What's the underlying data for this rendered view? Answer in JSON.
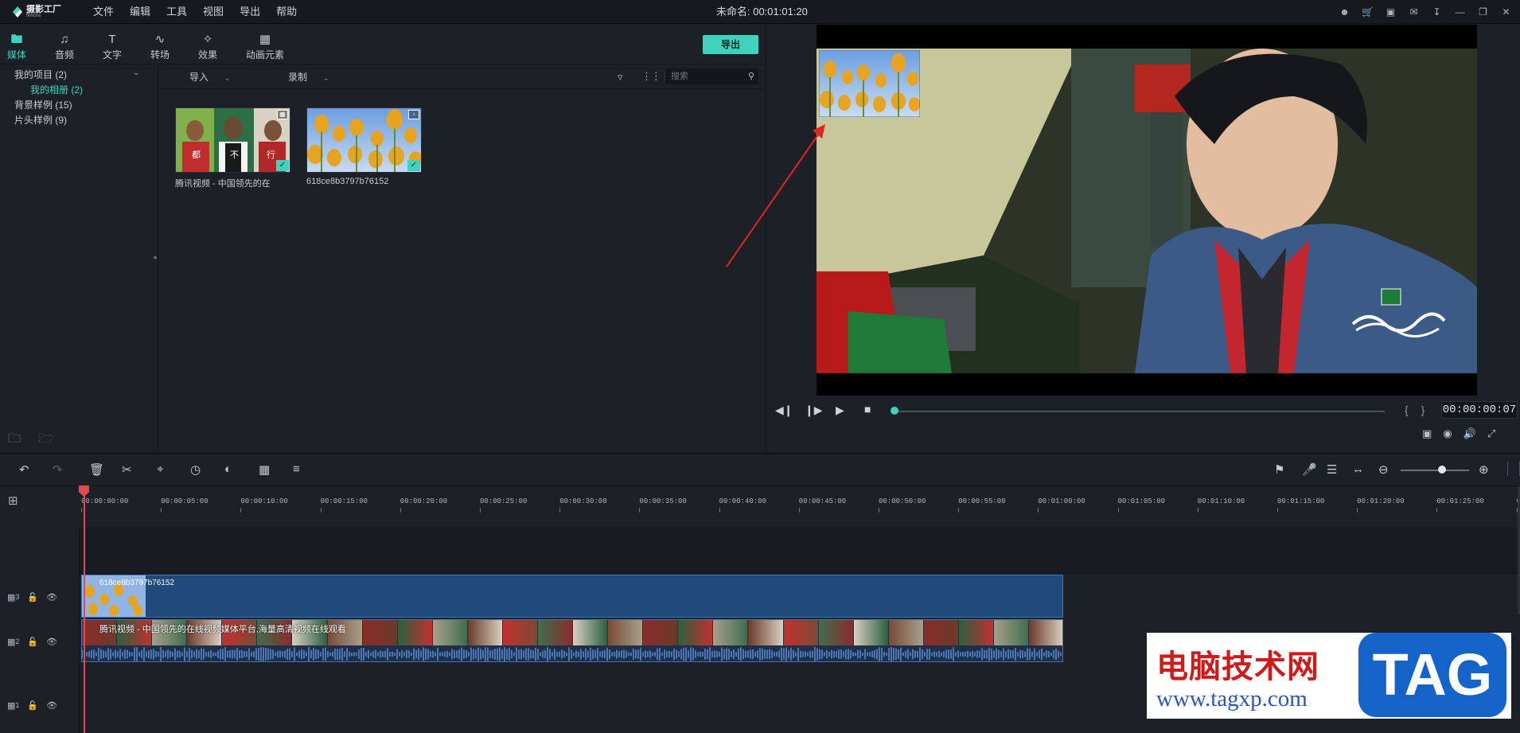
{
  "app": {
    "logo_name": "摄影工厂",
    "logo_sub": "filmora",
    "menu": [
      "文件",
      "编辑",
      "工具",
      "视图",
      "导出",
      "帮助"
    ],
    "document_title": "未命名: 00:01:01:20"
  },
  "library": {
    "tabs": [
      {
        "label": "媒体",
        "icon": "folder-icon"
      },
      {
        "label": "音频",
        "icon": "music-note-icon"
      },
      {
        "label": "文字",
        "icon": "text-icon"
      },
      {
        "label": "转场",
        "icon": "transition-icon"
      },
      {
        "label": "效果",
        "icon": "effects-icon"
      },
      {
        "label": "动画元素",
        "icon": "image-icon"
      }
    ],
    "export_label": "导出",
    "tree": [
      {
        "label": "我的项目 (2)"
      },
      {
        "label": "我的相册 (2)"
      },
      {
        "label": "背景样例 (15)"
      },
      {
        "label": "片头样例 (9)"
      }
    ],
    "toolbar": {
      "import_label": "导入",
      "record_label": "录制",
      "search_placeholder": "搜索"
    },
    "media": [
      {
        "name": "腾讯视频 - 中国领先的在",
        "type": "video"
      },
      {
        "name": "618ce8b3797b76152",
        "type": "image"
      }
    ]
  },
  "preview": {
    "timecode": "00:00:00:07",
    "progress": 0.0
  },
  "timeline": {
    "ruler_labels": [
      "00:00:00:00",
      "00:00:05:00",
      "00:00:10:00",
      "00:00:15:00",
      "00:00:20:00",
      "00:00:25:00",
      "00:00:30:00",
      "00:00:35:00",
      "00:00:40:00",
      "00:00:45:00",
      "00:00:50:00",
      "00:00:55:00",
      "00:01:00:00",
      "00:01:05:00",
      "00:01:10:00",
      "00:01:15:00",
      "00:01:20:00",
      "00:01:25:00",
      "00:"
    ],
    "tracks": [
      {
        "label": "3"
      },
      {
        "label": "2"
      },
      {
        "label": "1"
      }
    ],
    "clip_track3": "618ce8b3797b76152",
    "clip_track2": "腾讯视频 - 中国领先的在线视频媒体平台,海量高清视频在线观看"
  },
  "promo": {
    "title": "电脑技术网",
    "url": "www.tagxp.com",
    "tag": "TAG"
  },
  "colors": {
    "accent": "#3ed2bf",
    "playhead": "#e2494a",
    "clip_blue": "#1f4a7a"
  }
}
